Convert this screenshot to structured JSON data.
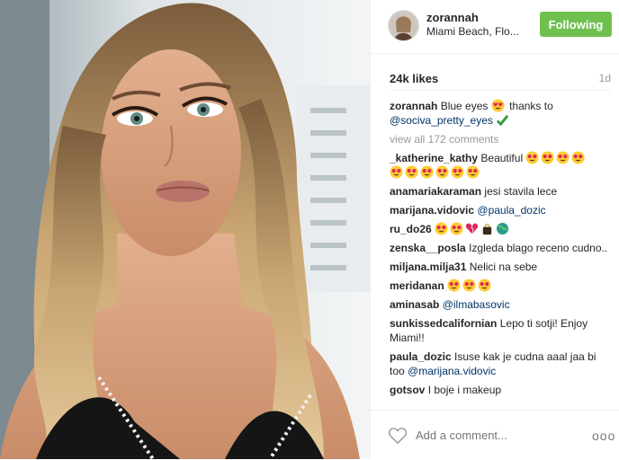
{
  "post": {
    "username": "zorannah",
    "location": "Miami Beach, Flo...",
    "follow_label": "Following",
    "likes": "24k likes",
    "time": "1d",
    "caption": {
      "user": "zorannah",
      "text_before": "Blue eyes",
      "text_after": "thanks to",
      "mention": "@sociva_pretty_eyes"
    },
    "view_all": "view all 172 comments",
    "add_comment_placeholder": "Add a comment...",
    "more_label": "ooo"
  },
  "comments": [
    {
      "user": "_katherine_kathy",
      "text": "Beautiful",
      "emoji": [
        "heart-eyes",
        "heart-eyes",
        "heart-eyes",
        "heart-eyes",
        "heart-eyes",
        "heart-eyes",
        "heart-eyes",
        "heart-eyes",
        "heart-eyes"
      ]
    },
    {
      "user": "anamariakaraman",
      "text": "jesi stavila lece"
    },
    {
      "user": "marijana.vidovic",
      "mention": "@paula_dozic"
    },
    {
      "user": "ru_do26",
      "emoji": [
        "heart-eyes",
        "heart-eyes",
        "broken-heart",
        "bag",
        "globe"
      ]
    },
    {
      "user": "zenska__posla",
      "text": "Izgleda blago receno cudno.."
    },
    {
      "user": "miljana.milja31",
      "text": "Nelici na sebe"
    },
    {
      "user": "meridanan",
      "emoji": [
        "heart-eyes",
        "heart-eyes",
        "heart-eyes"
      ]
    },
    {
      "user": "aminasab",
      "mention": "@ilmabasovic"
    },
    {
      "user": "sunkissedcalifornian",
      "text": "Lepo ti sotji! Enjoy Miami!!"
    },
    {
      "user": "paula_dozic",
      "text": "Isuse kak je cudna aaal jaa bi too",
      "mention": "@marijana.vidovic"
    },
    {
      "user": "gotsov",
      "text": "I boje i makeup"
    }
  ],
  "colors": {
    "follow_green": "#70c050",
    "mention_blue": "#003569",
    "emoji_yellow": "#ffcc33",
    "heart_red": "#e0245e"
  }
}
